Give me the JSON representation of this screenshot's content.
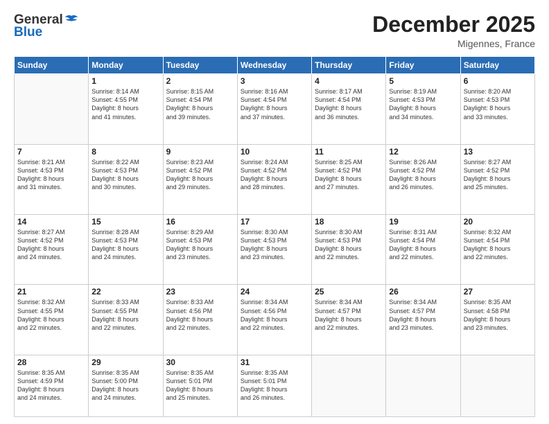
{
  "header": {
    "logo_general": "General",
    "logo_blue": "Blue",
    "month_title": "December 2025",
    "location": "Migennes, France"
  },
  "weekdays": [
    "Sunday",
    "Monday",
    "Tuesday",
    "Wednesday",
    "Thursday",
    "Friday",
    "Saturday"
  ],
  "weeks": [
    [
      {
        "day": "",
        "info": ""
      },
      {
        "day": "1",
        "info": "Sunrise: 8:14 AM\nSunset: 4:55 PM\nDaylight: 8 hours\nand 41 minutes."
      },
      {
        "day": "2",
        "info": "Sunrise: 8:15 AM\nSunset: 4:54 PM\nDaylight: 8 hours\nand 39 minutes."
      },
      {
        "day": "3",
        "info": "Sunrise: 8:16 AM\nSunset: 4:54 PM\nDaylight: 8 hours\nand 37 minutes."
      },
      {
        "day": "4",
        "info": "Sunrise: 8:17 AM\nSunset: 4:54 PM\nDaylight: 8 hours\nand 36 minutes."
      },
      {
        "day": "5",
        "info": "Sunrise: 8:19 AM\nSunset: 4:53 PM\nDaylight: 8 hours\nand 34 minutes."
      },
      {
        "day": "6",
        "info": "Sunrise: 8:20 AM\nSunset: 4:53 PM\nDaylight: 8 hours\nand 33 minutes."
      }
    ],
    [
      {
        "day": "7",
        "info": "Sunrise: 8:21 AM\nSunset: 4:53 PM\nDaylight: 8 hours\nand 31 minutes."
      },
      {
        "day": "8",
        "info": "Sunrise: 8:22 AM\nSunset: 4:53 PM\nDaylight: 8 hours\nand 30 minutes."
      },
      {
        "day": "9",
        "info": "Sunrise: 8:23 AM\nSunset: 4:52 PM\nDaylight: 8 hours\nand 29 minutes."
      },
      {
        "day": "10",
        "info": "Sunrise: 8:24 AM\nSunset: 4:52 PM\nDaylight: 8 hours\nand 28 minutes."
      },
      {
        "day": "11",
        "info": "Sunrise: 8:25 AM\nSunset: 4:52 PM\nDaylight: 8 hours\nand 27 minutes."
      },
      {
        "day": "12",
        "info": "Sunrise: 8:26 AM\nSunset: 4:52 PM\nDaylight: 8 hours\nand 26 minutes."
      },
      {
        "day": "13",
        "info": "Sunrise: 8:27 AM\nSunset: 4:52 PM\nDaylight: 8 hours\nand 25 minutes."
      }
    ],
    [
      {
        "day": "14",
        "info": "Sunrise: 8:27 AM\nSunset: 4:52 PM\nDaylight: 8 hours\nand 24 minutes."
      },
      {
        "day": "15",
        "info": "Sunrise: 8:28 AM\nSunset: 4:53 PM\nDaylight: 8 hours\nand 24 minutes."
      },
      {
        "day": "16",
        "info": "Sunrise: 8:29 AM\nSunset: 4:53 PM\nDaylight: 8 hours\nand 23 minutes."
      },
      {
        "day": "17",
        "info": "Sunrise: 8:30 AM\nSunset: 4:53 PM\nDaylight: 8 hours\nand 23 minutes."
      },
      {
        "day": "18",
        "info": "Sunrise: 8:30 AM\nSunset: 4:53 PM\nDaylight: 8 hours\nand 22 minutes."
      },
      {
        "day": "19",
        "info": "Sunrise: 8:31 AM\nSunset: 4:54 PM\nDaylight: 8 hours\nand 22 minutes."
      },
      {
        "day": "20",
        "info": "Sunrise: 8:32 AM\nSunset: 4:54 PM\nDaylight: 8 hours\nand 22 minutes."
      }
    ],
    [
      {
        "day": "21",
        "info": "Sunrise: 8:32 AM\nSunset: 4:55 PM\nDaylight: 8 hours\nand 22 minutes."
      },
      {
        "day": "22",
        "info": "Sunrise: 8:33 AM\nSunset: 4:55 PM\nDaylight: 8 hours\nand 22 minutes."
      },
      {
        "day": "23",
        "info": "Sunrise: 8:33 AM\nSunset: 4:56 PM\nDaylight: 8 hours\nand 22 minutes."
      },
      {
        "day": "24",
        "info": "Sunrise: 8:34 AM\nSunset: 4:56 PM\nDaylight: 8 hours\nand 22 minutes."
      },
      {
        "day": "25",
        "info": "Sunrise: 8:34 AM\nSunset: 4:57 PM\nDaylight: 8 hours\nand 22 minutes."
      },
      {
        "day": "26",
        "info": "Sunrise: 8:34 AM\nSunset: 4:57 PM\nDaylight: 8 hours\nand 23 minutes."
      },
      {
        "day": "27",
        "info": "Sunrise: 8:35 AM\nSunset: 4:58 PM\nDaylight: 8 hours\nand 23 minutes."
      }
    ],
    [
      {
        "day": "28",
        "info": "Sunrise: 8:35 AM\nSunset: 4:59 PM\nDaylight: 8 hours\nand 24 minutes."
      },
      {
        "day": "29",
        "info": "Sunrise: 8:35 AM\nSunset: 5:00 PM\nDaylight: 8 hours\nand 24 minutes."
      },
      {
        "day": "30",
        "info": "Sunrise: 8:35 AM\nSunset: 5:01 PM\nDaylight: 8 hours\nand 25 minutes."
      },
      {
        "day": "31",
        "info": "Sunrise: 8:35 AM\nSunset: 5:01 PM\nDaylight: 8 hours\nand 26 minutes."
      },
      {
        "day": "",
        "info": ""
      },
      {
        "day": "",
        "info": ""
      },
      {
        "day": "",
        "info": ""
      }
    ]
  ]
}
